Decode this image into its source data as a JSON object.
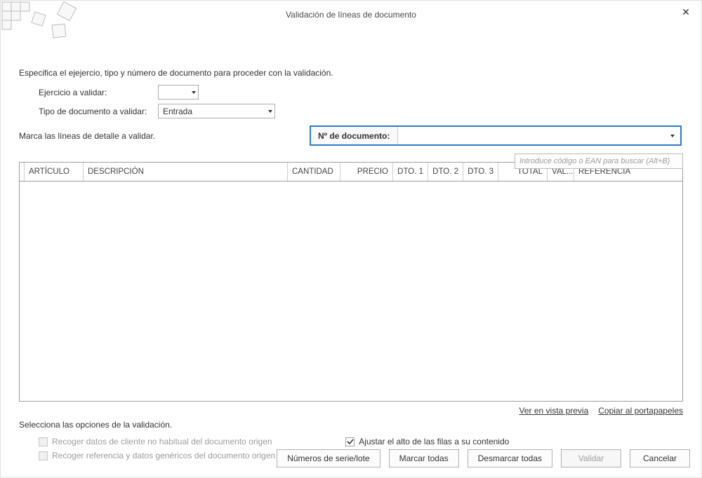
{
  "window": {
    "title": "Validación de líneas de documento"
  },
  "instructions": {
    "specify": "Especifica el ejejercio, tipo y número de documento para proceder con la validación.",
    "mark": "Marca las líneas de detalle a validar.",
    "select_opts": "Selecciona las opciones de la validación."
  },
  "form": {
    "ejercicio_label": "Ejercicio a validar:",
    "tipodoc_label": "Tipo de documento a validar:",
    "tipodoc_value": "Entrada",
    "ndoc_label": "Nº de documento:"
  },
  "search": {
    "placeholder": "Introduce código o EAN para buscar (Alt+B)"
  },
  "grid": {
    "columns": {
      "articulo": "ARTÍCULO",
      "descripcion": "DESCRIPCIÓN",
      "cantidad": "CANTIDAD",
      "precio": "PRECIO",
      "dto1": "DTO. 1",
      "dto2": "DTO. 2",
      "dto3": "DTO. 3",
      "total": "TOTAL",
      "val": "VAL...",
      "referencia": "REFERENCIA"
    }
  },
  "links": {
    "preview": "Ver en vista previa",
    "clipboard": "Copiar al portapapeles"
  },
  "options": {
    "recoger_cliente": "Recoger datos de cliente no habitual del documento origen",
    "recoger_ref": "Recoger referencia y datos genéricos del documento origen",
    "ajustar_alto": "Ajustar el alto de las filas a su contenido"
  },
  "buttons": {
    "serie": "Números de serie/lote",
    "marcar": "Marcar todas",
    "desmarcar": "Desmarcar todas",
    "validar": "Validar",
    "cancelar": "Cancelar"
  }
}
